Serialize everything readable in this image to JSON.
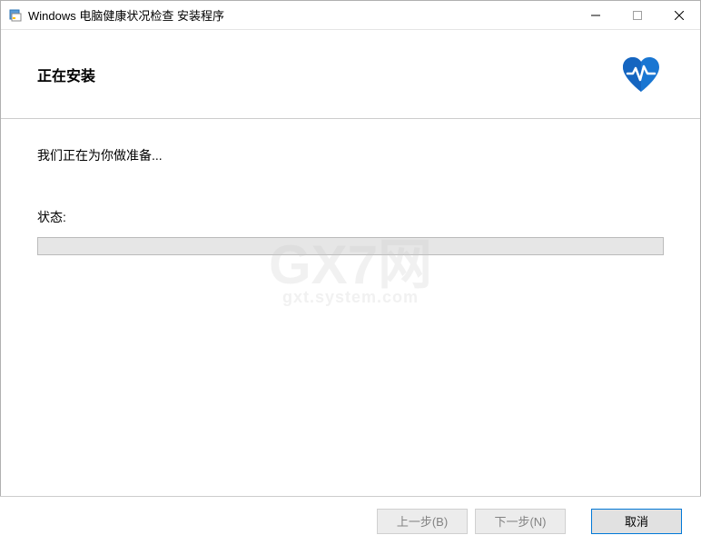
{
  "titlebar": {
    "title": "Windows 电脑健康状况检查 安装程序"
  },
  "header": {
    "title": "正在安装"
  },
  "content": {
    "preparing": "我们正在为你做准备...",
    "status_label": "状态:"
  },
  "footer": {
    "back_label": "上一步(B)",
    "next_label": "下一步(N)",
    "cancel_label": "取消"
  },
  "watermark": {
    "main": "GX7网",
    "sub": "gxt.system.com"
  }
}
